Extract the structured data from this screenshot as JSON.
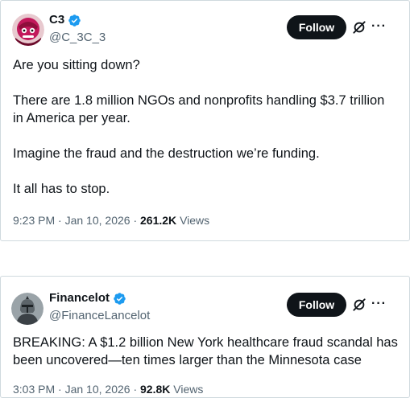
{
  "tweets": [
    {
      "display_name": "C3",
      "handle": "@C_3C_3",
      "follow_label": "Follow",
      "paragraphs": [
        "Are you sitting down?",
        "There are 1.8 million NGOs and nonprofits handling $3.7 trillion in America per year.",
        "Imagine the fraud and the destruction we’re funding.",
        "It all has to stop."
      ],
      "time": "9:23 PM",
      "date": "Jan 10, 2026",
      "views_count": "261.2K",
      "views_label": "Views"
    },
    {
      "display_name": "Financelot",
      "handle": "@FinanceLancelot",
      "follow_label": "Follow",
      "paragraphs": [
        "BREAKING: A $1.2 billion New York healthcare fraud scandal has been uncovered—ten times larger than the Minnesota case"
      ],
      "time": "3:03 PM",
      "date": "Jan 10, 2026",
      "views_count": "92.8K",
      "views_label": "Views"
    }
  ],
  "separator": "·",
  "more_glyph": "···",
  "colors": {
    "verified_blue": "#1d9bf0",
    "follow_bg": "#0f1419",
    "muted_text": "#536471",
    "border": "#cfd9de"
  },
  "icons": [
    "verified-badge-icon",
    "grok-icon",
    "more-options-icon"
  ]
}
